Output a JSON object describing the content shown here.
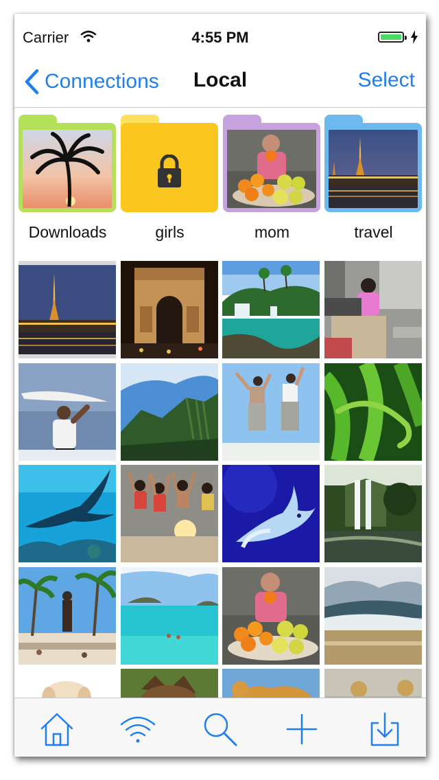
{
  "status_bar": {
    "carrier": "Carrier",
    "time": "4:55 PM",
    "battery_level_fraction": 1.0,
    "icons": [
      "wifi-icon",
      "battery-icon",
      "charging-bolt-icon"
    ]
  },
  "nav_bar": {
    "back_label": "Connections",
    "title": "Local",
    "select_label": "Select"
  },
  "folders": [
    {
      "label": "Downloads",
      "color": "#b5e15a",
      "content": "palm-tree-sunset"
    },
    {
      "label": "girls",
      "color": "#fbc61f",
      "content": "lock-icon"
    },
    {
      "label": "mom",
      "color": "#c6a3dd",
      "content": "woman-with-fruit"
    },
    {
      "label": "travel",
      "color": "#6db8ee",
      "content": "paris-eiffel-night"
    }
  ],
  "photos": [
    "paris-eiffel-night",
    "arc-de-triomphe-night",
    "tropical-waterfall-lagoon",
    "girl-at-desk",
    "surfer-with-board",
    "green-mountain-ridge",
    "two-women-jumping",
    "green-lizard-on-fern",
    "manta-ray",
    "girls-jumping-on-beach",
    "blue-fish-underwater",
    "waterfall-forest",
    "palm-beach-statue",
    "beach-island-swimmers",
    "woman-with-fruit",
    "waves-on-shore",
    "puppy",
    "dog-in-grass",
    "lioness",
    "cheetahs"
  ],
  "toolbar": {
    "items": [
      "home-icon",
      "wifi-icon",
      "search-icon",
      "add-icon",
      "download-icon"
    ]
  },
  "colors": {
    "accent": "#1f7fef",
    "battery_fill": "#4cd964"
  }
}
